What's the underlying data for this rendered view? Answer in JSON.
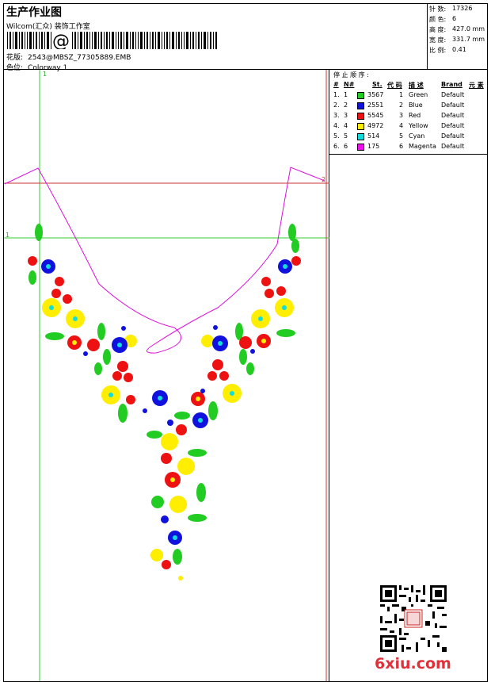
{
  "header": {
    "title": "生产作业图",
    "company": "Wilcom(汇众) 装饰工作室",
    "barcode_glyph": "@",
    "file_label": "花版:",
    "file_value": "2543@MBSZ_77305889.EMB",
    "colorway_label": "色位:",
    "colorway_value": "Colorway 1"
  },
  "stats": [
    {
      "label": "针 数:",
      "value": "17326"
    },
    {
      "label": "颜 色:",
      "value": "6"
    },
    {
      "label": "高 度:",
      "value": "427.0 mm"
    },
    {
      "label": "宽 度:",
      "value": "331.7 mm"
    },
    {
      "label": "比 例:",
      "value": "0.41"
    }
  ],
  "legend": {
    "title": "停 止 顺 序 :",
    "headers": [
      "#",
      "N#",
      "St.",
      "代 码",
      "描 述",
      "Brand",
      "元 素"
    ],
    "rows": [
      {
        "idx": "1.",
        "n": "1",
        "color": "#22cc22",
        "st": "3567",
        "code": "1",
        "desc": "Green",
        "brand": "Default"
      },
      {
        "idx": "2.",
        "n": "2",
        "color": "#1111dd",
        "st": "2551",
        "code": "2",
        "desc": "Blue",
        "brand": "Default"
      },
      {
        "idx": "3.",
        "n": "3",
        "color": "#ee1111",
        "st": "5545",
        "code": "3",
        "desc": "Red",
        "brand": "Default"
      },
      {
        "idx": "4.",
        "n": "4",
        "color": "#ffee00",
        "st": "4972",
        "code": "4",
        "desc": "Yellow",
        "brand": "Default"
      },
      {
        "idx": "5.",
        "n": "5",
        "color": "#11dddd",
        "st": "514",
        "code": "5",
        "desc": "Cyan",
        "brand": "Default"
      },
      {
        "idx": "6.",
        "n": "6",
        "color": "#ee11ee",
        "st": "175",
        "code": "6",
        "desc": "Magenta",
        "brand": "Default"
      }
    ]
  },
  "canvas": {
    "guide_labels": [
      "1",
      "1",
      "2"
    ]
  },
  "watermark": "6xiu.com",
  "colors": {
    "green": "#22cc22",
    "blue": "#1111dd",
    "red": "#ee1111",
    "yellow": "#ffee00",
    "cyan": "#11dddd",
    "magenta": "#ee11ee",
    "guide_green": "#33cc33",
    "guide_red": "#cc3333"
  }
}
